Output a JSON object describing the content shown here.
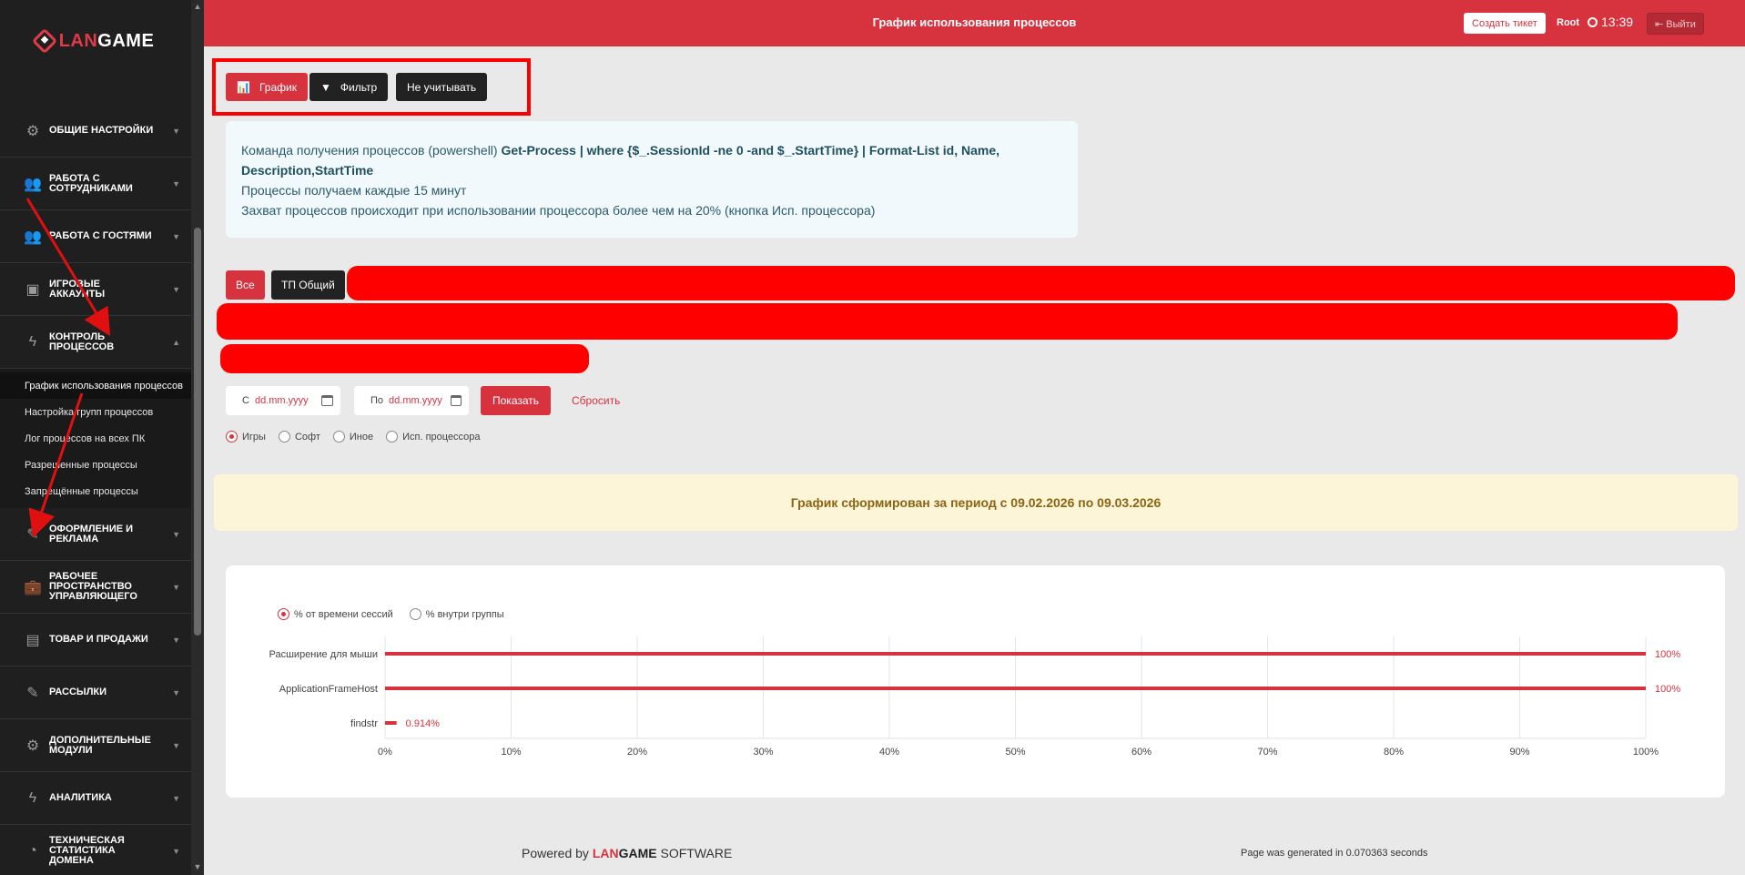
{
  "brand": {
    "logo_text_red": "LAN",
    "logo_text_white": "GAME"
  },
  "header": {
    "title": "График использования процессов",
    "create_ticket": "Создать тикет",
    "user": "Root",
    "time": "13:39",
    "logout": "Выйти"
  },
  "sidebar": {
    "items": [
      {
        "label": "Общие настройки",
        "icon": "gear-icon"
      },
      {
        "label": "Работа с сотрудниками",
        "icon": "users-icon"
      },
      {
        "label": "Работа с гостями",
        "icon": "users-icon"
      },
      {
        "label": "Игровые аккаунты",
        "icon": "account-icon"
      },
      {
        "label": "Контроль процессов",
        "icon": "bolt-icon"
      },
      {
        "label": "Оформление и реклама",
        "icon": "edit-icon"
      },
      {
        "label": "Рабочее пространство управляющего",
        "icon": "briefcase-icon"
      },
      {
        "label": "Товар и продажи",
        "icon": "note-icon"
      },
      {
        "label": "Рассылки",
        "icon": "edit-icon"
      },
      {
        "label": "Дополнительные модули",
        "icon": "gear-icon"
      },
      {
        "label": "Аналитика",
        "icon": "bolt-icon"
      },
      {
        "label": "Техническая статистика домена",
        "icon": "pie-icon"
      }
    ],
    "subitems": [
      "График использования процессов",
      "Настройка групп процессов",
      "Лог процессов на всех ПК",
      "Разрешенные процессы",
      "Запрещённые процессы"
    ]
  },
  "toolbar": {
    "chart": "График",
    "filter": "Фильтр",
    "ignore": "Не учитывать"
  },
  "info": {
    "line1_prefix": "Команда получения процессов (powershell) ",
    "line1_cmd": "Get-Process | where {$_.SessionId -ne 0 -and $_.StartTime} | Format-List id, Name, Description,StartTime",
    "line2": "Процессы получаем каждые 15 минут",
    "line3": "Захват процессов происходит при использовании процессора более чем на 20% (кнопка Исп. процессора)"
  },
  "filters": {
    "all": "Все",
    "tp_general": "ТП Общий"
  },
  "date": {
    "from_label": "С",
    "to_label": "По",
    "placeholder": "dd.mm.yyyy",
    "show": "Показать",
    "reset": "Сбросить"
  },
  "categories": {
    "options": [
      "Игры",
      "Софт",
      "Иное",
      "Исп. процессора"
    ],
    "selected": "Игры"
  },
  "alert": {
    "text": "График сформирован за период с 09.02.2026 по 09.03.2026"
  },
  "chart_modes": {
    "options": [
      "% от времени сессий",
      "% внутри группы"
    ],
    "selected": "% от времени сессий"
  },
  "chart_data": {
    "type": "bar",
    "orientation": "horizontal",
    "categories": [
      "Расширение для мыши",
      "ApplicationFrameHost",
      "findstr"
    ],
    "values": [
      100,
      100,
      0.914
    ],
    "value_labels": [
      "100%",
      "100%",
      "0.914%"
    ],
    "xlim": [
      0,
      100
    ],
    "x_ticks": [
      "0%",
      "10%",
      "20%",
      "30%",
      "40%",
      "50%",
      "60%",
      "70%",
      "80%",
      "90%",
      "100%"
    ],
    "grid": true,
    "bar_color": "#d6333f"
  },
  "footer": {
    "powered_by": "Powered by",
    "brand_red": "LAN",
    "brand_dark": "GAME",
    "software": "SOFTWARE",
    "generated": "Page was generated in 0.070363 seconds"
  }
}
